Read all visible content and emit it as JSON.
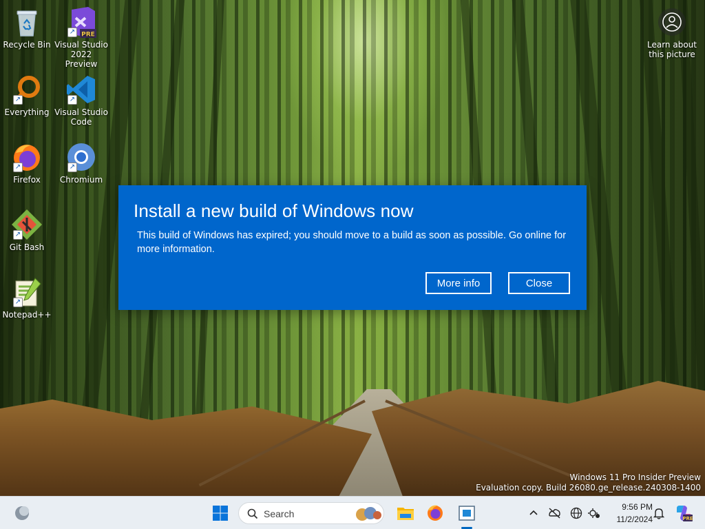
{
  "desktop": {
    "icons": [
      {
        "label": "Recycle Bin",
        "icon": "recycle-bin-icon"
      },
      {
        "label": "Visual Studio 2022 Preview",
        "icon": "visual-studio-icon",
        "badge": "PRE"
      },
      {
        "label": "Everything",
        "icon": "everything-search-icon"
      },
      {
        "label": "Visual Studio Code",
        "icon": "vscode-icon"
      },
      {
        "label": "Firefox",
        "icon": "firefox-icon"
      },
      {
        "label": "Chromium",
        "icon": "chromium-icon"
      },
      {
        "label": "Git Bash",
        "icon": "git-bash-icon"
      },
      {
        "label": "Notepad++",
        "icon": "notepad-plus-plus-icon"
      }
    ],
    "learn_about": "Learn about this picture",
    "watermark": {
      "line1": "Windows 11 Pro Insider Preview",
      "line2": "Evaluation copy. Build 26080.ge_release.240308-1400"
    }
  },
  "dialog": {
    "title": "Install a new build of Windows now",
    "message": "This build of Windows has expired; you should move to a build as soon as possible. Go online for more information.",
    "more_info_label": "More info",
    "close_label": "Close",
    "background_color": "#0066cc"
  },
  "taskbar": {
    "search_placeholder": "Search",
    "clock_time": "9:56 PM",
    "clock_date": "11/2/2024",
    "pinned": [
      "widgets-icon",
      "start-icon",
      "search-icon",
      "file-explorer-icon",
      "firefox-icon",
      "task-view-app-icon"
    ],
    "tray": [
      "chevron-up-icon",
      "network-off-icon",
      "globe-icon",
      "settings-sync-icon",
      "notification-bell-icon",
      "copilot-icon"
    ]
  }
}
